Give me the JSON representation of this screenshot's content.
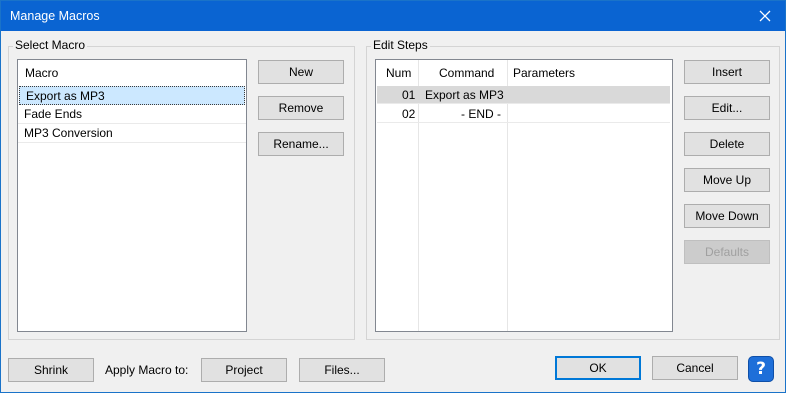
{
  "window": {
    "title": "Manage Macros"
  },
  "select_macro": {
    "group_label": "Select Macro",
    "column_header": "Macro",
    "items": [
      "Export as MP3",
      "Fade Ends",
      "MP3 Conversion"
    ],
    "buttons": {
      "new": "New",
      "remove": "Remove",
      "rename": "Rename..."
    }
  },
  "edit_steps": {
    "group_label": "Edit Steps",
    "columns": {
      "num": "Num",
      "command": "Command",
      "parameters": "Parameters"
    },
    "rows": [
      {
        "num": "01",
        "command": "Export as MP3",
        "parameters": ""
      },
      {
        "num": "02",
        "command": "- END -",
        "parameters": ""
      }
    ],
    "buttons": {
      "insert": "Insert",
      "edit": "Edit...",
      "delete": "Delete",
      "move_up": "Move Up",
      "move_down": "Move Down",
      "defaults": "Defaults"
    }
  },
  "footer": {
    "shrink": "Shrink",
    "apply_label": "Apply Macro to:",
    "project": "Project",
    "files": "Files...",
    "ok": "OK",
    "cancel": "Cancel",
    "help": "?"
  },
  "colors": {
    "titlebar": "#0a64d2",
    "selection": "#cce8ff",
    "help": "#1e6fd9"
  }
}
